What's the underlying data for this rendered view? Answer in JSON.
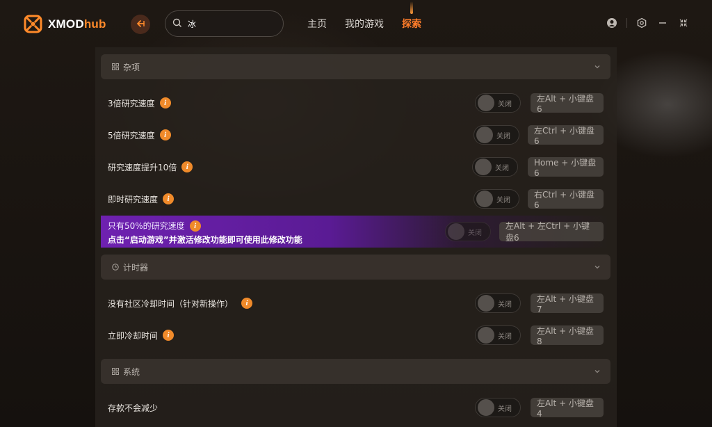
{
  "app": {
    "name_main": "XMOD",
    "name_accent": "hub"
  },
  "search": {
    "value": "冰"
  },
  "nav": [
    {
      "label": "主页",
      "active": false
    },
    {
      "label": "我的游戏",
      "active": false
    },
    {
      "label": "探索",
      "active": true
    }
  ],
  "colors": {
    "accent": "#ff7d2a",
    "info": "#f08a2a",
    "highlight": "#6e21b0"
  },
  "sections": [
    {
      "title": "杂项",
      "icon": "grid-icon",
      "rows": [
        {
          "label": "3倍研究速度",
          "toggle": "关闭",
          "hotkey": "左Alt + 小键盘6"
        },
        {
          "label": "5倍研究速度",
          "toggle": "关闭",
          "hotkey": "左Ctrl + 小键盘6"
        },
        {
          "label": "研究速度提升10倍",
          "toggle": "关闭",
          "hotkey": "Home + 小键盘6"
        },
        {
          "label": "即时研究速度",
          "toggle": "关闭",
          "hotkey": "右Ctrl + 小键盘6"
        },
        {
          "label": "只有50%的研究速度",
          "note": "点击“启动游戏”并激活修改功能即可使用此修改功能",
          "toggle": "关闭",
          "hotkey": "左Alt + 左Ctrl + 小键盘6"
        }
      ]
    },
    {
      "title": "计时器",
      "icon": "clock-icon",
      "rows": [
        {
          "label": "没有社区冷却时间（针对新操作）",
          "toggle": "关闭",
          "hotkey": "左Alt + 小键盘7"
        },
        {
          "label": "立即冷却时间",
          "toggle": "关闭",
          "hotkey": "左Alt + 小键盘8"
        }
      ]
    },
    {
      "title": "系统",
      "icon": "grid-icon",
      "rows": [
        {
          "label": "存款不会减少",
          "toggle": "关闭",
          "hotkey": "左Alt + 小键盘4"
        }
      ]
    }
  ]
}
